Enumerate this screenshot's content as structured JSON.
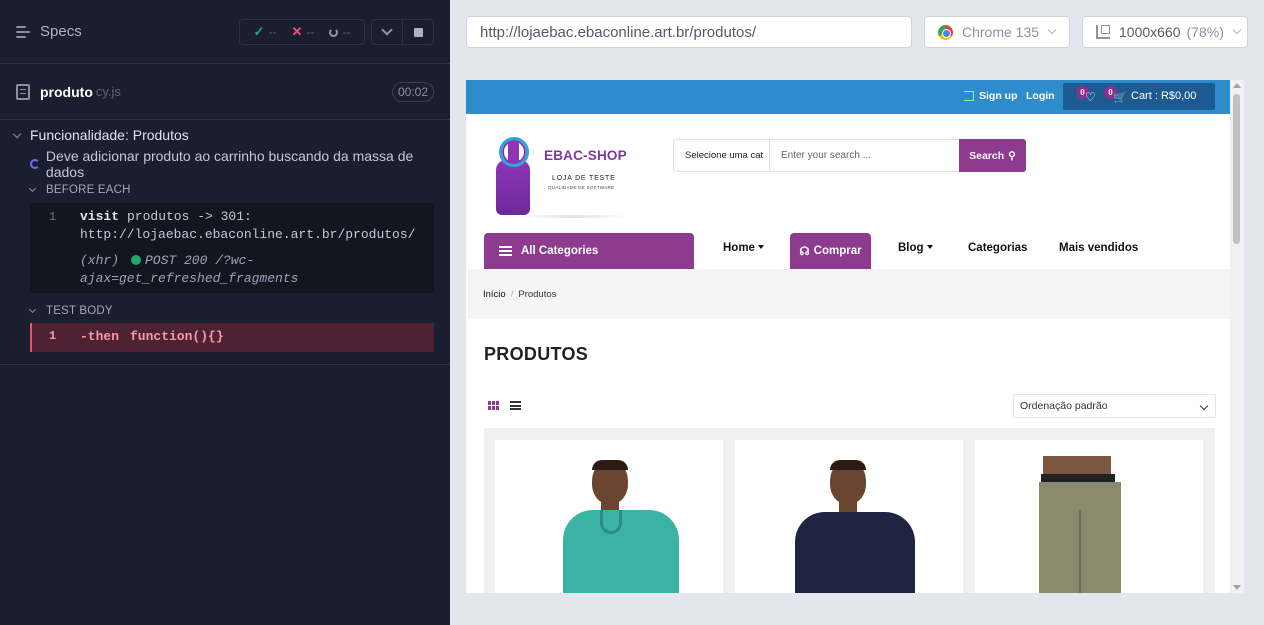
{
  "reporter": {
    "header": {
      "title": "Specs"
    },
    "stats": {
      "passed": "--",
      "failed": "--",
      "pending": "--"
    },
    "spec": {
      "name": "produto",
      "ext": "cy.js",
      "duration": "00:02"
    },
    "suite": {
      "title": "Funcionalidade: Produtos"
    },
    "test": {
      "title": "Deve adicionar produto ao carrinho buscando da massa de dados"
    },
    "before_each": {
      "label": "BEFORE EACH",
      "num": "1",
      "cmd": "visit",
      "msg_line1": "produtos -> 301:",
      "msg_line2": "http://lojaebac.ebaconline.art.br/produtos/",
      "xhr_label": "(xhr)",
      "xhr_line1": "POST 200 /?wc-",
      "xhr_line2": "ajax=get_refreshed_fragments"
    },
    "test_body": {
      "label": "TEST BODY",
      "num": "1",
      "cmd": "-then",
      "msg": "function(){}"
    }
  },
  "aut": {
    "url": "http://lojaebac.ebaconline.art.br/produtos/",
    "browser": "Chrome 135",
    "viewport": "1000x660",
    "scale": "(78%)",
    "site": {
      "signup": "Sign up",
      "login": "Login",
      "wishlist_count": "0",
      "cart_count": "0",
      "cart_label": "Cart : R$0,00",
      "logo_title": "EBAC-SHOP",
      "logo_sub": "LOJA DE TESTE",
      "logo_tagline": "QUALIDADE DE SOFTWARE",
      "search_category": "Selecione uma cat",
      "search_placeholder": "Enter your search ...",
      "search_button": "Search",
      "all_categories": "All Categories",
      "nav": {
        "home": "Home",
        "comprar": "Comprar",
        "blog": "Blog",
        "categorias": "Categorias",
        "mais_vendidos": "Mais vendidos"
      },
      "breadcrumb": {
        "home": "Início",
        "sep": "/",
        "current": "Produtos"
      },
      "page_title": "PRODUTOS",
      "ordering": "Ordenação padrão"
    }
  },
  "colors": {
    "reporter_bg": "#1b1e2e",
    "pass": "#1fa971",
    "fail": "#e45770",
    "site_blue": "#2f8ccc",
    "site_purple": "#8e3a8e"
  }
}
